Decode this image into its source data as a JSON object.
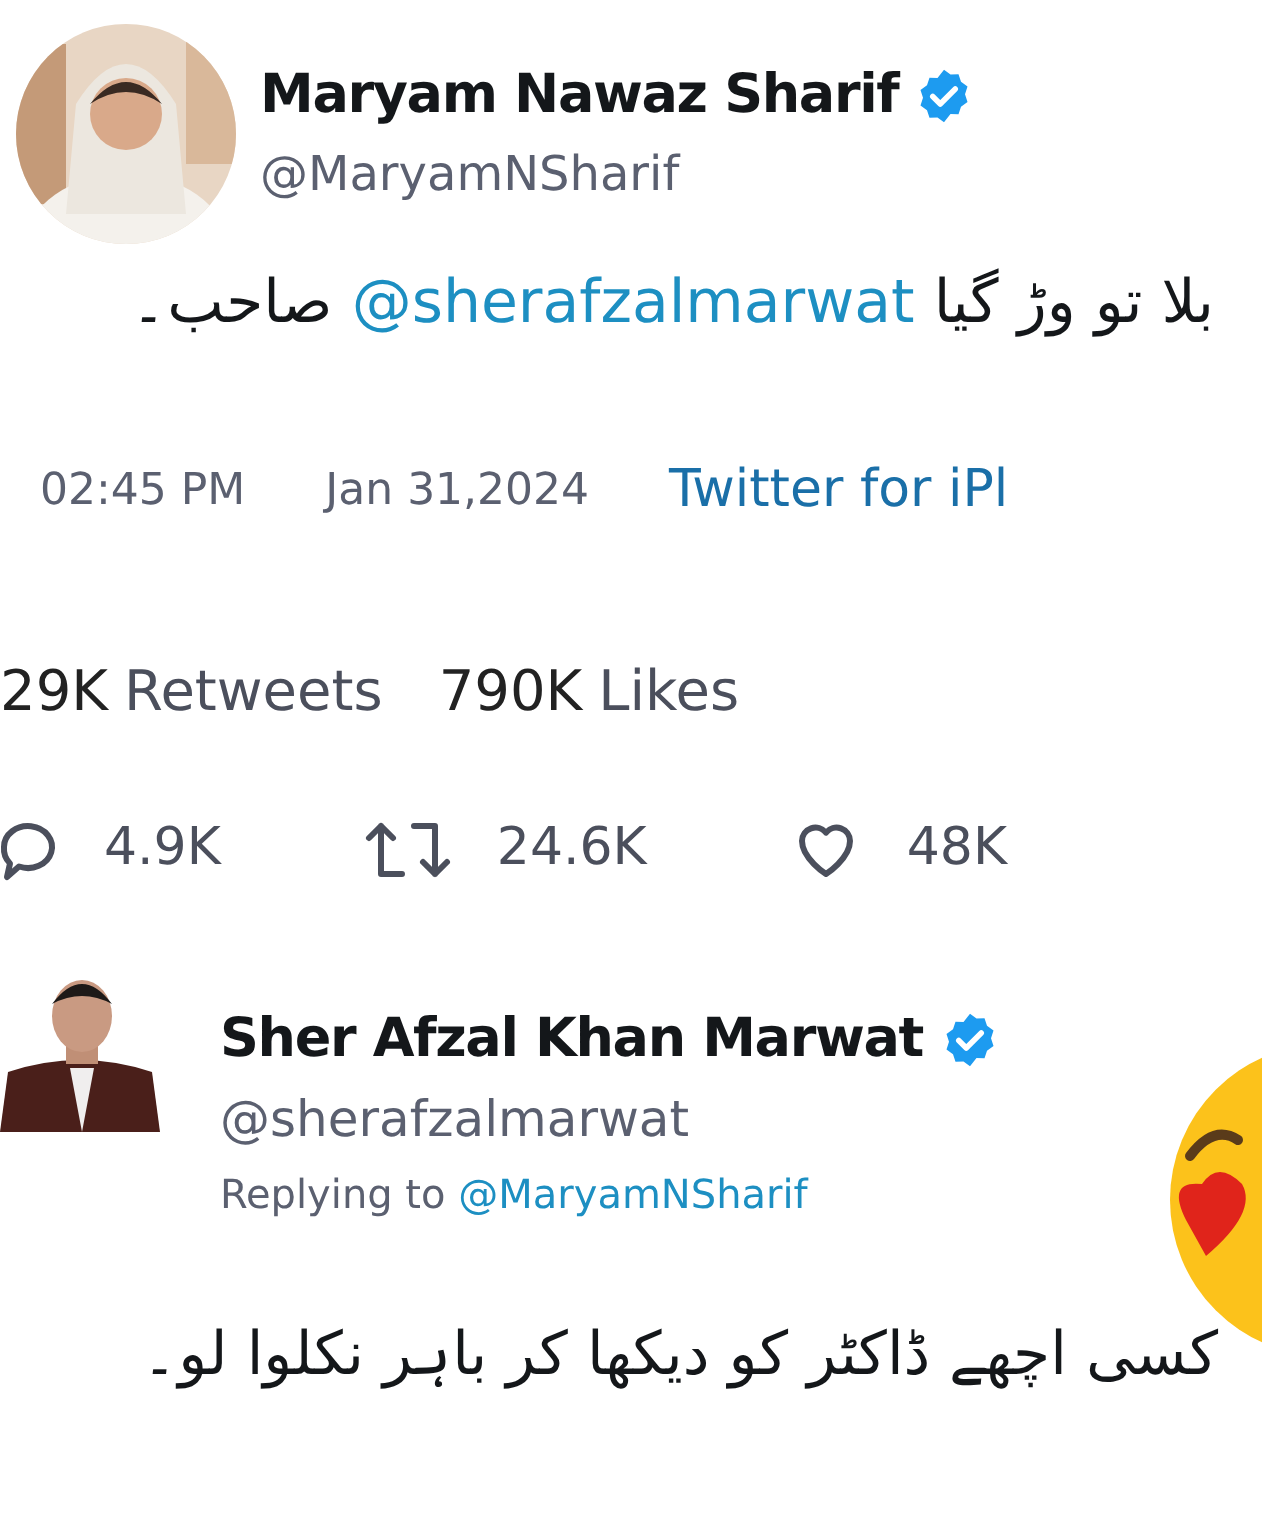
{
  "tweet": {
    "name": "Maryam Nawaz Sharif",
    "verified": true,
    "handle": "@MaryamNSharif",
    "text": [
      {
        "kind": "text",
        "text": "بلا تو وڑ گیا"
      },
      {
        "kind": "mention",
        "text": "@sherafzalmarwat"
      },
      {
        "kind": "text",
        "text": "صاحب۔"
      }
    ],
    "time": "02:45 PM",
    "date": "Jan 31,2024",
    "source": "Twitter for iPl",
    "stats": [
      {
        "count": "29K",
        "label": "Retweets"
      },
      {
        "count": "790K",
        "label": "Likes"
      }
    ],
    "actions": [
      {
        "kind": "reply",
        "count": "4.9K"
      },
      {
        "kind": "retweet",
        "count": "24.6K"
      },
      {
        "kind": "like",
        "count": "48K"
      }
    ]
  },
  "reply": {
    "name": "Sher Afzal Khan Marwat",
    "verified": true,
    "handle": "@sherafzalmarwat",
    "replying_label": "Replying to",
    "replying_to": "@MaryamNSharif",
    "text": "کسی اچھے ڈاکٹر کو دیکھا کر باہر نکلوا لو۔"
  }
}
